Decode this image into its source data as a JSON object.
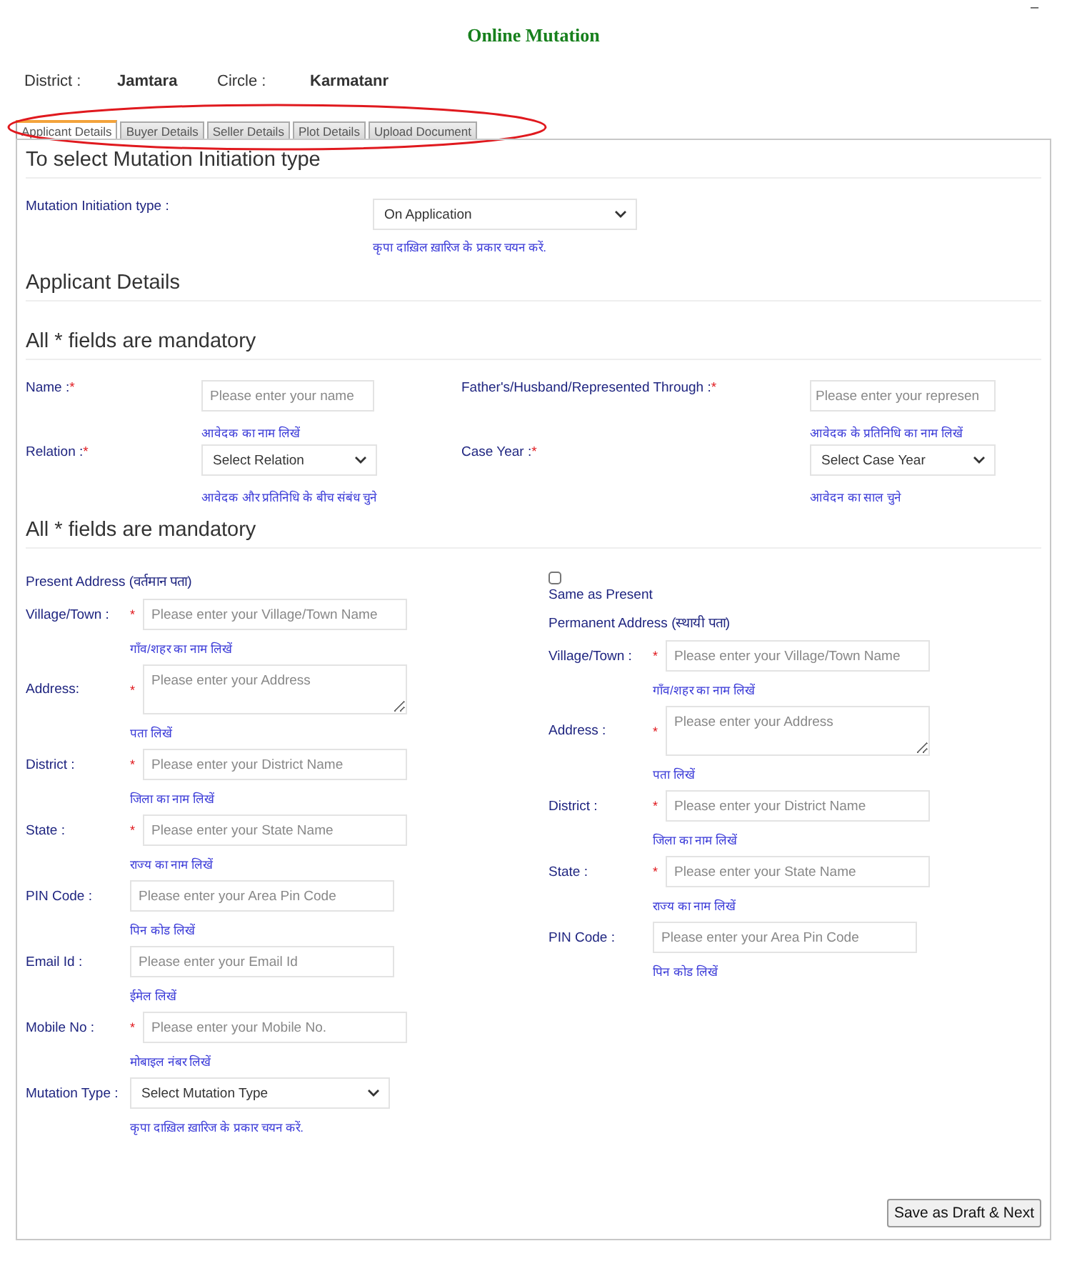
{
  "corner_mark": "–",
  "title": "Online Mutation",
  "location": [
    {
      "label": "District :",
      "value": "Jamtara"
    },
    {
      "label": "Circle :",
      "value": "Karmatanr"
    }
  ],
  "tabs": [
    {
      "label": "Applicant Details",
      "selected": true
    },
    {
      "label": "Buyer Details",
      "selected": false
    },
    {
      "label": "Seller Details",
      "selected": false
    },
    {
      "label": "Plot Details",
      "selected": false
    },
    {
      "label": "Upload Document",
      "selected": false
    }
  ],
  "required_mark": "*",
  "initiation": {
    "heading": "To select Mutation Initiation type",
    "label": "Mutation Initiation type :",
    "value": "On Application",
    "hint": "कृपा दाख़िल ख़ारिज के प्रकार चयन करें."
  },
  "applicant": {
    "heading": "Applicant Details",
    "mandatory": "All * fields are mandatory",
    "fields": [
      {
        "label": "Name :",
        "required": true,
        "kind": "input",
        "placeholder": "Please enter your name",
        "hint": "आवेदक का नाम लिखें"
      },
      {
        "label": "Father's/Husband/Represented Through :",
        "required": true,
        "kind": "input",
        "placeholder": "Please enter your represen",
        "hint": "आवेदक के प्रतिनिधि का नाम लिखें"
      },
      {
        "label": "Relation :",
        "required": true,
        "kind": "select",
        "value": "Select Relation",
        "hint": "आवेदक और प्रतिनिधि के बीच संबंध चुने"
      },
      {
        "label": "Case Year :",
        "required": true,
        "kind": "select",
        "value": "Select Case Year",
        "hint": "आवेदन का साल चुने"
      }
    ]
  },
  "address": {
    "mandatory": "All * fields are mandatory",
    "present": {
      "title": "Present Address (वर्तमान पता)",
      "fields": [
        {
          "label": "Village/Town :",
          "required": true,
          "kind": "input",
          "placeholder": "Please enter your Village/Town Name",
          "hint": "गाँव/शहर का नाम लिखें"
        },
        {
          "label": "Address:",
          "required": true,
          "kind": "textarea",
          "placeholder": "Please enter your Address",
          "hint": "पता लिखें"
        },
        {
          "label": "District :",
          "required": true,
          "kind": "input",
          "placeholder": "Please enter your District Name",
          "hint": "जिला का नाम लिखें"
        },
        {
          "label": "State :",
          "required": true,
          "kind": "input",
          "placeholder": "Please enter your State Name",
          "hint": "राज्य का नाम लिखें"
        },
        {
          "label": "PIN Code :",
          "required": false,
          "kind": "input",
          "placeholder": "Please enter your Area Pin Code",
          "hint": "पिन कोड लिखें"
        },
        {
          "label": "Email Id :",
          "required": false,
          "kind": "input",
          "placeholder": "Please enter your Email Id",
          "hint": "ईमेल लिखें"
        },
        {
          "label": "Mobile No :",
          "required": true,
          "kind": "input",
          "placeholder": "Please enter your Mobile No.",
          "hint": "मोबाइल नंबर लिखें"
        },
        {
          "label": "Mutation Type :",
          "required": false,
          "kind": "select",
          "value": "Select Mutation Type",
          "hint": "कृपा दाख़िल ख़ारिज के प्रकार चयन करें."
        }
      ]
    },
    "permanent": {
      "same_as_present": {
        "label": "Same as Present",
        "checked": false
      },
      "title": "Permanent Address (स्थायी पता)",
      "fields": [
        {
          "label": "Village/Town :",
          "required": true,
          "kind": "input",
          "placeholder": "Please enter your Village/Town Name",
          "hint": "गाँव/शहर का नाम लिखें"
        },
        {
          "label": "Address :",
          "required": true,
          "kind": "textarea",
          "placeholder": "Please enter your Address",
          "hint": "पता लिखें"
        },
        {
          "label": "District :",
          "required": true,
          "kind": "input",
          "placeholder": "Please enter your District Name",
          "hint": "जिला का नाम लिखें"
        },
        {
          "label": "State :",
          "required": true,
          "kind": "input",
          "placeholder": "Please enter your State Name",
          "hint": "राज्य का नाम लिखें"
        },
        {
          "label": "PIN Code :",
          "required": false,
          "kind": "input",
          "placeholder": "Please enter your Area Pin Code",
          "hint": "पिन कोड लिखें"
        }
      ]
    }
  },
  "save_button": "Save as Draft & Next"
}
